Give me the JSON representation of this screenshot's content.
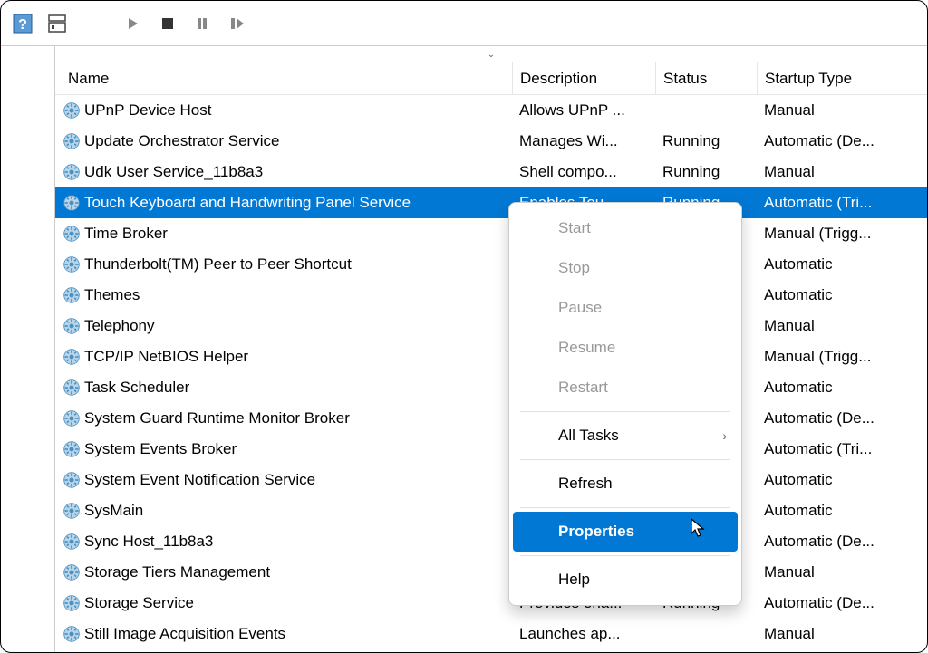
{
  "columns": {
    "name": "Name",
    "description": "Description",
    "status": "Status",
    "startup": "Startup Type"
  },
  "rows": [
    {
      "name": "UPnP Device Host",
      "description": "Allows UPnP ...",
      "status": "",
      "startup": "Manual"
    },
    {
      "name": "Update Orchestrator Service",
      "description": "Manages Wi...",
      "status": "Running",
      "startup": "Automatic (De..."
    },
    {
      "name": "Udk User Service_11b8a3",
      "description": "Shell compo...",
      "status": "Running",
      "startup": "Manual"
    },
    {
      "name": "Touch Keyboard and Handwriting Panel Service",
      "description": "Enables Tou...",
      "status": "Running",
      "startup": "Automatic (Tri..."
    },
    {
      "name": "Time Broker",
      "description": "",
      "status": "",
      "startup": "Manual (Trigg..."
    },
    {
      "name": "Thunderbolt(TM) Peer to Peer Shortcut",
      "description": "",
      "status": "",
      "startup": "Automatic"
    },
    {
      "name": "Themes",
      "description": "",
      "status": "",
      "startup": "Automatic"
    },
    {
      "name": "Telephony",
      "description": "",
      "status": "",
      "startup": "Manual"
    },
    {
      "name": "TCP/IP NetBIOS Helper",
      "description": "",
      "status": "",
      "startup": "Manual (Trigg..."
    },
    {
      "name": "Task Scheduler",
      "description": "",
      "status": "",
      "startup": "Automatic"
    },
    {
      "name": "System Guard Runtime Monitor Broker",
      "description": "",
      "status": "",
      "startup": "Automatic (De..."
    },
    {
      "name": "System Events Broker",
      "description": "",
      "status": "",
      "startup": "Automatic (Tri..."
    },
    {
      "name": "System Event Notification Service",
      "description": "",
      "status": "",
      "startup": "Automatic"
    },
    {
      "name": "SysMain",
      "description": "",
      "status": "",
      "startup": "Automatic"
    },
    {
      "name": "Sync Host_11b8a3",
      "description": "",
      "status": "",
      "startup": "Automatic (De..."
    },
    {
      "name": "Storage Tiers Management",
      "description": "",
      "status": "",
      "startup": "Manual"
    },
    {
      "name": "Storage Service",
      "description": "Provides ena...",
      "status": "Running",
      "startup": "Automatic (De..."
    },
    {
      "name": "Still Image Acquisition Events",
      "description": "Launches ap...",
      "status": "",
      "startup": "Manual"
    }
  ],
  "selectedRowIndex": 3,
  "contextMenu": {
    "items": [
      {
        "label": "Start",
        "disabled": true
      },
      {
        "label": "Stop",
        "disabled": true
      },
      {
        "label": "Pause",
        "disabled": true
      },
      {
        "label": "Resume",
        "disabled": true
      },
      {
        "label": "Restart",
        "disabled": true
      },
      {
        "separator": true
      },
      {
        "label": "All Tasks",
        "submenu": true
      },
      {
        "separator": true
      },
      {
        "label": "Refresh"
      },
      {
        "separator": true
      },
      {
        "label": "Properties",
        "highlighted": true
      },
      {
        "separator": true
      },
      {
        "label": "Help"
      }
    ]
  }
}
